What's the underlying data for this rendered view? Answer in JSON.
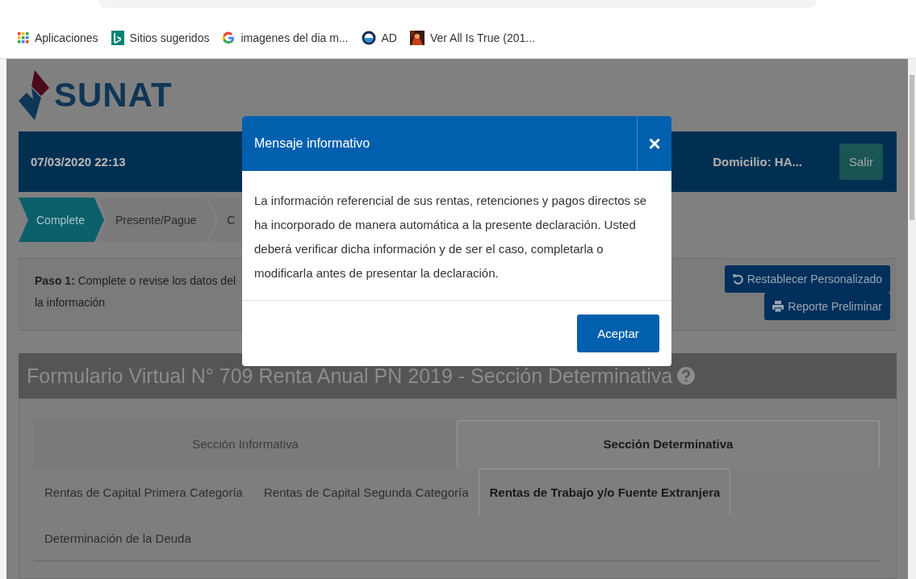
{
  "bookmarks": [
    {
      "label": "Aplicaciones",
      "kind": "apps"
    },
    {
      "label": "Sitios sugeridos",
      "kind": "bing"
    },
    {
      "label": "imagenes del dia m...",
      "kind": "google"
    },
    {
      "label": "AD",
      "kind": "circle"
    },
    {
      "label": "Ver All Is True (201...",
      "kind": "picture"
    }
  ],
  "header": {
    "logo": "SUNAT",
    "datetime": "07/03/2020 22:13",
    "domicilio": "Domicilio: HA...",
    "logout": "Salir"
  },
  "steps": [
    {
      "label": "Complete",
      "selected": true
    },
    {
      "label": "Presente/Pague",
      "selected": false
    },
    {
      "label": "C",
      "selected": false
    }
  ],
  "instructions": {
    "lines": [
      "**Paso 1:** Complete o revise los datos del",
      "la información"
    ],
    "buttons": [
      {
        "label": "Restablecer Personalizado",
        "kind": "reset"
      },
      {
        "label": "Reporte Preliminar",
        "kind": "print"
      }
    ]
  },
  "form": {
    "title": "Formulario Virtual N° 709 Renta Anual PN 2019 - Sección Determinativa",
    "sections": [
      {
        "label": "Sección Informativa",
        "selected": false
      },
      {
        "label": "Sección Determinativa",
        "selected": true
      }
    ],
    "subtabs": [
      {
        "label": "Rentas de Capital Primera Categoría",
        "selected": false
      },
      {
        "label": "Rentas de Capital Segunda Categoría",
        "selected": false
      },
      {
        "label": "Rentas de Trabajo y/o Fuente Extranjera",
        "selected": true
      },
      {
        "label": "Determinación de la Deuda",
        "selected": false
      }
    ]
  },
  "modal": {
    "title": "Mensaje informativo",
    "close": "×",
    "body": "La información referencial de sus rentas, retenciones y pagos directos se ha incorporado de manera automática a la presente declaración. Usted deberá verificar dicha información y de ser el caso, completarla o modificarla antes de presentar la declaración.",
    "accept": "Aceptar"
  }
}
